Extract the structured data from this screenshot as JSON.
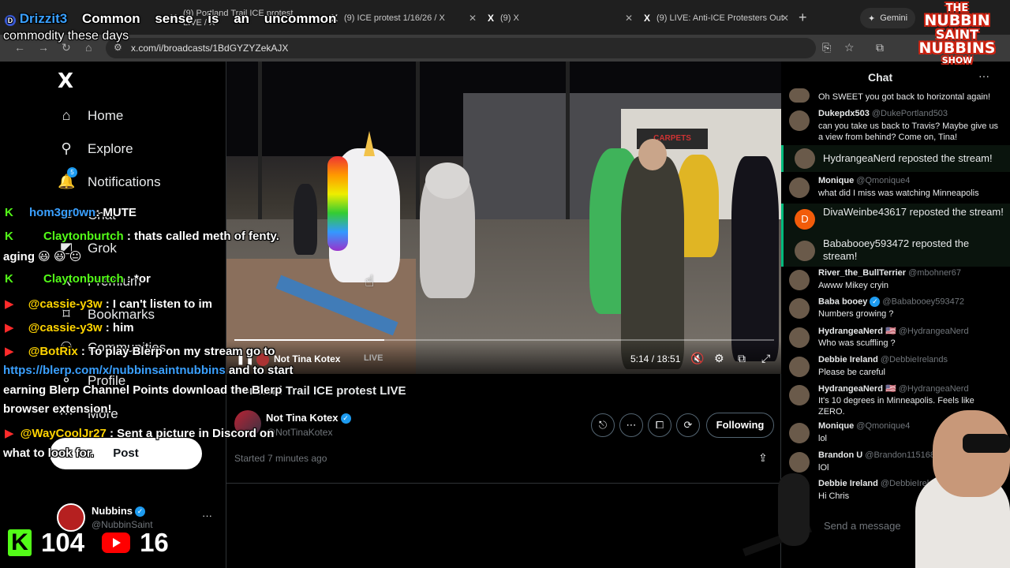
{
  "browser": {
    "tabs": [
      {
        "title": "(9) Portland Trail ICE protest LIVE / X"
      },
      {
        "title": "(9) ICE protest 1/16/26 / X"
      },
      {
        "title": "(9) X"
      },
      {
        "title": "(9) LIVE: Anti-ICE Protesters Out"
      }
    ],
    "new_tab": "+",
    "gemini_label": "Gemini",
    "url": "x.com/i/broadcasts/1BdGYZYZekAJX"
  },
  "sidebar": {
    "logo": "X",
    "items": [
      {
        "label": "Home",
        "icon": "home-icon",
        "glyph": "⌂"
      },
      {
        "label": "Explore",
        "icon": "search-icon",
        "glyph": "⚲"
      },
      {
        "label": "Notifications",
        "icon": "bell-icon",
        "glyph": "🔔",
        "badge": "5"
      },
      {
        "label": "Chat",
        "icon": "chat-icon",
        "glyph": "✉"
      },
      {
        "label": "Grok",
        "icon": "grok-icon",
        "glyph": "◩"
      },
      {
        "label": "Premium",
        "icon": "x-premium-icon",
        "glyph": "X"
      },
      {
        "label": "Bookmarks",
        "icon": "bookmark-icon",
        "glyph": "⌑"
      },
      {
        "label": "Communities",
        "icon": "communities-icon",
        "glyph": "⚇"
      },
      {
        "label": "Profile",
        "icon": "profile-icon",
        "glyph": "⚬"
      },
      {
        "label": "More",
        "icon": "more-circle-icon",
        "glyph": "⋯"
      }
    ],
    "post_button": "Post",
    "account": {
      "name": "Nubbins",
      "handle": "@NubbinSaint",
      "more": "···"
    }
  },
  "video": {
    "host": "Not Tina Kotex",
    "live_label": "LIVE",
    "time": "5:14 / 18:51",
    "progress": 0.278,
    "scene_sign": "CARPETS"
  },
  "broadcast": {
    "title": "Portland Trail ICE protest LIVE",
    "host_name": "Not Tina Kotex",
    "host_handle": "@NotTinaKotex",
    "follow_label": "Following",
    "started": "Started 7 minutes ago"
  },
  "chat": {
    "title": "Chat",
    "more": "···",
    "messages": [
      {
        "user": "",
        "handle": "",
        "text": "Oh SWEET you got back to horizontal again!"
      },
      {
        "user": "Dukepdx503",
        "handle": "@DukePortland503",
        "text": "can you take us back to Travis? Maybe give us a view from behind? Come on, Tina!"
      },
      {
        "repost": "HydrangeaNerd reposted the stream!"
      },
      {
        "user": "Monique",
        "handle": "@Qmonique4",
        "text": "what did I miss was watching Minneapolis"
      },
      {
        "repost": "DivaWeinbe43617 reposted the stream!",
        "initial": "D"
      },
      {
        "repost": "Bababooey593472 reposted the stream!"
      },
      {
        "user": "River_the_BullTerrier",
        "handle": "@mbohner67",
        "text": "Awww Mikey cryin"
      },
      {
        "user": "Baba booey",
        "handle": "@Bababooey593472",
        "text": "Numbers growing ?"
      },
      {
        "user": "HydrangeaNerd 🇺🇸",
        "handle": "@HydrangeaNerd",
        "text": "Who was scuffling ?"
      },
      {
        "user": "Debbie Ireland",
        "handle": "@DebbieIrelands",
        "text": "Please be careful"
      },
      {
        "user": "HydrangeaNerd 🇺🇸",
        "handle": "@HydrangeaNerd",
        "text": "It's 10 degrees in Minneapolis. Feels like ZERO."
      },
      {
        "user": "Monique",
        "handle": "@Qmonique4",
        "text": "lol"
      },
      {
        "user": "Brandon U",
        "handle": "@Brandon11516898",
        "text": "lOl"
      },
      {
        "user": "Debbie Ireland",
        "handle": "@DebbieIrelands",
        "text": "Hi Chris"
      }
    ],
    "input_placeholder": "Send a message"
  },
  "overlay": {
    "top_user": "Drizzit3",
    "top_text": "Common sense is an uncommon commodity these days",
    "top_words": [
      "Common",
      "sense",
      "is",
      "an",
      "uncommon"
    ],
    "top_line2": "commodity these days",
    "lines": [
      {
        "user": "hom3gr0wn",
        "text": ": MUTE"
      },
      {
        "user": "Claytonburtch",
        "text": ": thats called meth of fenty."
      },
      {
        "text": "aging 😃 😃 😐"
      },
      {
        "user": "Claytonburtch",
        "text": ": *or"
      },
      {
        "user": "@cassie-y3w",
        "text": ": I can't listen to im"
      },
      {
        "user": "@cassie-y3w",
        "text": ": him"
      },
      {
        "user": "@BotRix",
        "text": ": To play Blerp on my stream go to"
      },
      {
        "link": "https://blerp.com/x/nubbinsaintnubbins",
        "text": " and to start"
      },
      {
        "text": "earning Blerp Channel Points download the Blerp"
      },
      {
        "text": "browser extension!"
      },
      {
        "user": "@WayCoolJr27",
        "text": ": Sent a picture in Discord on"
      },
      {
        "text": "what to look for."
      }
    ],
    "kick_count": "104",
    "youtube_count": "16",
    "brand": [
      "THE",
      "NUBBIN",
      "SAINT",
      "NUBBINS",
      "SHOW"
    ]
  },
  "colors": {
    "accent": "#1d9bf0",
    "kick": "#53fc18",
    "youtube": "#ff0000",
    "repost": "#00ba7c"
  }
}
